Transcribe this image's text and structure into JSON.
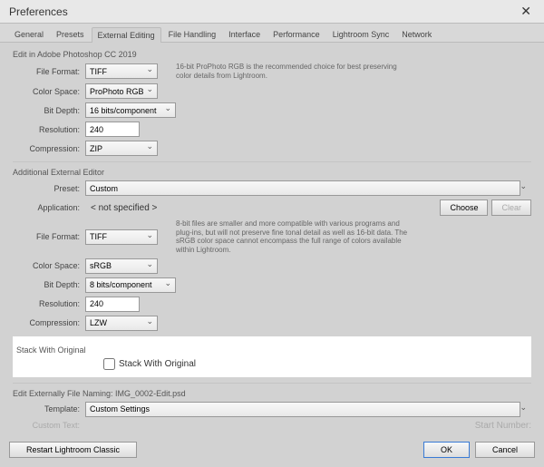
{
  "title": "Preferences",
  "tabs": [
    "General",
    "Presets",
    "External Editing",
    "File Handling",
    "Interface",
    "Performance",
    "Lightroom Sync",
    "Network"
  ],
  "activeTab": "External Editing",
  "section1": {
    "title": "Edit in Adobe Photoshop CC 2019",
    "fileFormatLabel": "File Format:",
    "fileFormat": "TIFF",
    "colorSpaceLabel": "Color Space:",
    "colorSpace": "ProPhoto RGB",
    "bitDepthLabel": "Bit Depth:",
    "bitDepth": "16 bits/component",
    "resolutionLabel": "Resolution:",
    "resolution": "240",
    "compressionLabel": "Compression:",
    "compression": "ZIP",
    "hint": "16-bit ProPhoto RGB is the recommended choice for best preserving color details from Lightroom."
  },
  "section2": {
    "title": "Additional External Editor",
    "presetLabel": "Preset:",
    "preset": "Custom",
    "applicationLabel": "Application:",
    "application": "< not specified >",
    "chooseLabel": "Choose",
    "clearLabel": "Clear",
    "fileFormatLabel": "File Format:",
    "fileFormat": "TIFF",
    "colorSpaceLabel": "Color Space:",
    "colorSpace": "sRGB",
    "bitDepthLabel": "Bit Depth:",
    "bitDepth": "8 bits/component",
    "resolutionLabel": "Resolution:",
    "resolution": "240",
    "compressionLabel": "Compression:",
    "compression": "LZW",
    "hint": "8-bit files are smaller and more compatible with various programs and plug-ins, but will not preserve fine tonal detail as well as 16-bit data. The sRGB color space cannot encompass the full range of colors available within Lightroom."
  },
  "stack": {
    "title": "Stack With Original",
    "checkboxLabel": "Stack With Original"
  },
  "naming": {
    "title": "Edit Externally File Naming:  IMG_0002-Edit.psd",
    "templateLabel": "Template:",
    "template": "Custom Settings",
    "customTextLabel": "Custom Text:",
    "startNumberLabel": "Start Number:"
  },
  "footer": {
    "restart": "Restart Lightroom Classic",
    "ok": "OK",
    "cancel": "Cancel"
  }
}
